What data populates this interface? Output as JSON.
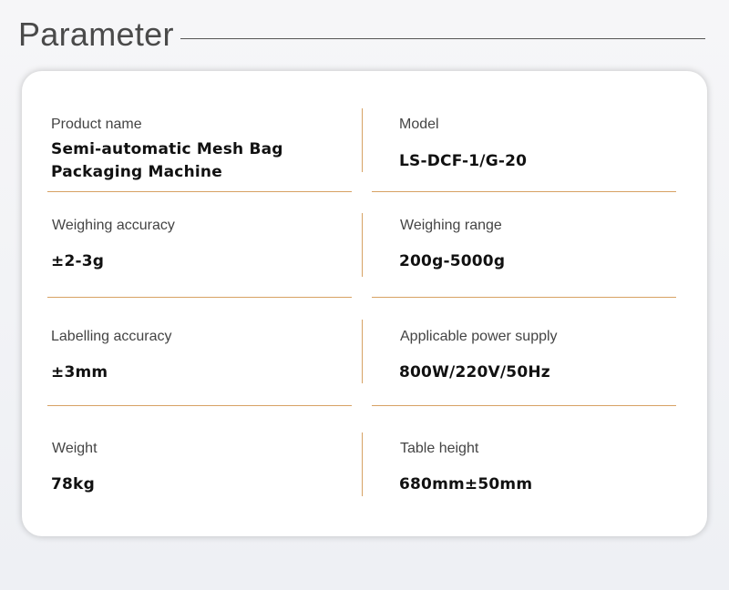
{
  "page": {
    "title": "Parameter"
  },
  "params": [
    {
      "label": "Product name",
      "value": "Semi-automatic Mesh Bag Packaging Machine"
    },
    {
      "label": "Model",
      "value": "LS-DCF-1/G-20"
    },
    {
      "label": "Weighing accuracy",
      "value": "±2-3g"
    },
    {
      "label": "Weighing range",
      "value": "200g-5000g"
    },
    {
      "label": "Labelling accuracy",
      "value": "±3mm"
    },
    {
      "label": "Applicable power supply",
      "value": "800W/220V/50Hz"
    },
    {
      "label": "Weight",
      "value": "78kg"
    },
    {
      "label": "Table height",
      "value": "680mm±50mm"
    }
  ],
  "colors": {
    "divider": "#d7a264",
    "heading_text": "#4a4a4a",
    "card_background": "#ffffff"
  }
}
